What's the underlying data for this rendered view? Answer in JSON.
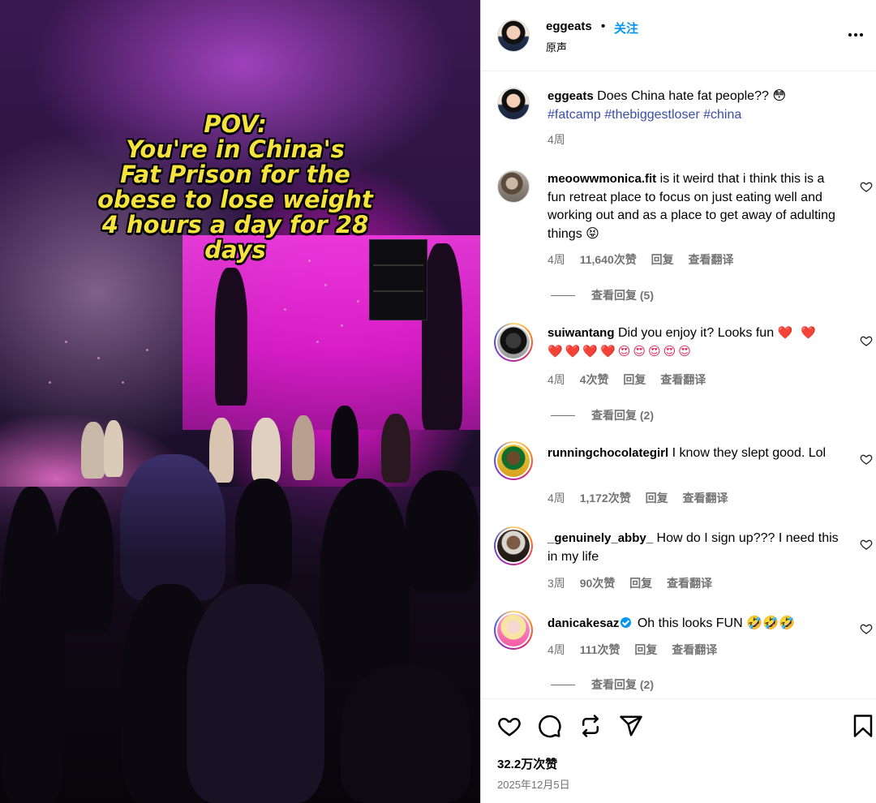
{
  "media": {
    "overlay_lines": [
      "POV:",
      "You're in China's",
      "Fat Prison for the",
      "obese to lose weight",
      "4 hours a day for 28",
      "days"
    ]
  },
  "header": {
    "username": "eggeats",
    "separator": "•",
    "follow_label": "关注",
    "subtitle": "原声",
    "more_icon": "more-horizontal-icon"
  },
  "caption": {
    "username": "eggeats",
    "text": "Does China hate fat people?? 😳",
    "hashtags": "#fatcamp #thebiggestloser #china",
    "time": "4周"
  },
  "comments": [
    {
      "username": "meoowwmonica.fit",
      "text": "is it weird that i think this is a fun retreat place to focus on just eating well and working out and as a place to get away of adulting things 😝",
      "time": "4周",
      "likes": "11,640次赞",
      "reply": "回复",
      "translate": "查看翻译",
      "view_replies": "查看回复 (5)"
    },
    {
      "username": "suiwantang",
      "text": "Did you enjoy it? Looks fun",
      "hearts_inline": "❤️ ❤️",
      "emoji_line": "❤️❤️❤️❤️😍😍😍😍😍",
      "time": "4周",
      "likes": "4次赞",
      "reply": "回复",
      "translate": "查看翻译",
      "view_replies": "查看回复 (2)"
    },
    {
      "username": "runningchocolategirl",
      "text": "I know they slept good. Lol",
      "time": "4周",
      "likes": "1,172次赞",
      "reply": "回复",
      "translate": "查看翻译"
    },
    {
      "username": "_genuinely_abby_",
      "text": "How do I sign up??? I need this in my life",
      "time": "3周",
      "likes": "90次赞",
      "reply": "回复",
      "translate": "查看翻译"
    },
    {
      "username": "danicakesaz",
      "text": "Oh this looks FUN 🤣🤣🤣",
      "time": "4周",
      "likes": "111次赞",
      "reply": "回复",
      "translate": "查看翻译",
      "view_replies": "查看回复 (2)"
    }
  ],
  "footer": {
    "likes": "32.2万次赞",
    "date": "2025年12月5日",
    "icons": [
      "heart-icon",
      "comment-icon",
      "repost-icon",
      "share-icon",
      "bookmark-icon"
    ]
  }
}
